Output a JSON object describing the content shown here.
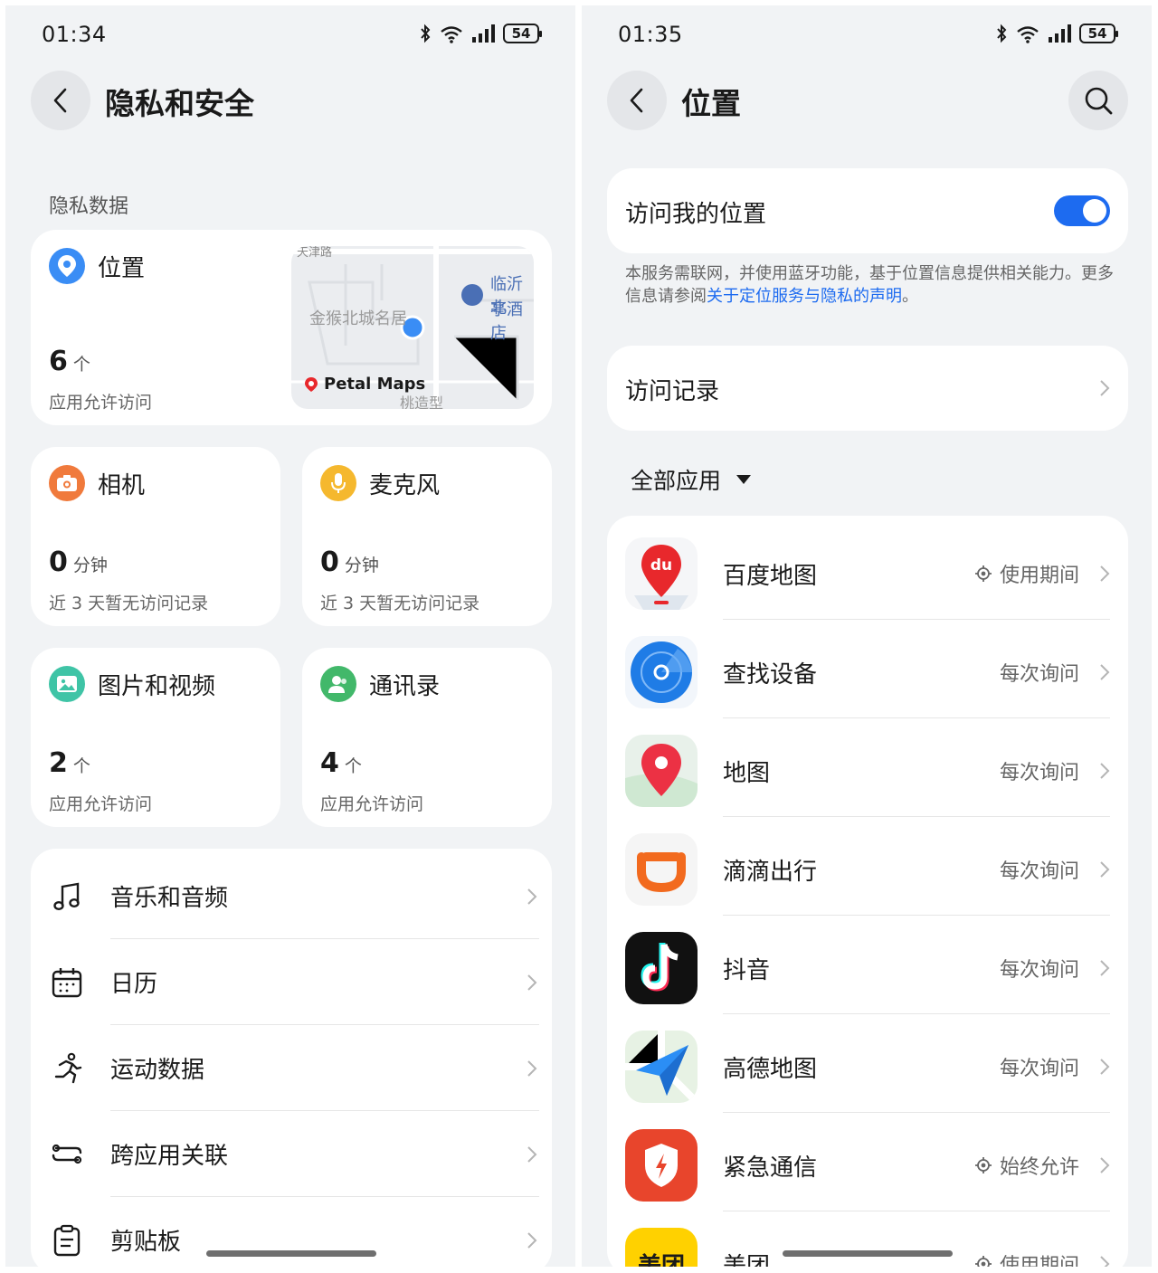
{
  "left_screen": {
    "status": {
      "time": "01:34",
      "battery": "54"
    },
    "title": "隐私和安全",
    "section_label": "隐私数据",
    "location_card": {
      "name": "位置",
      "count": "6",
      "unit": "个",
      "sub": "应用允许访问",
      "map": {
        "street": "天津路",
        "place": "金猴北城名居",
        "hotel_line1": "临沂北",
        "hotel_line2": "亭酒店",
        "brand": "Petal Maps",
        "place2": "桃造型"
      }
    },
    "camera_card": {
      "name": "相机",
      "count": "0",
      "unit": "分钟",
      "sub": "近 3 天暂无访问记录"
    },
    "mic_card": {
      "name": "麦克风",
      "count": "0",
      "unit": "分钟",
      "sub": "近 3 天暂无访问记录"
    },
    "photos_card": {
      "name": "图片和视频",
      "count": "2",
      "unit": "个",
      "sub": "应用允许访问"
    },
    "contacts_card": {
      "name": "通讯录",
      "count": "4",
      "unit": "个",
      "sub": "应用允许访问"
    },
    "list": [
      {
        "label": "音乐和音频",
        "icon": "music-note-icon"
      },
      {
        "label": "日历",
        "icon": "calendar-icon"
      },
      {
        "label": "运动数据",
        "icon": "running-icon"
      },
      {
        "label": "跨应用关联",
        "icon": "cross-app-icon"
      },
      {
        "label": "剪贴板",
        "icon": "clipboard-icon"
      }
    ]
  },
  "right_screen": {
    "status": {
      "time": "01:35",
      "battery": "54"
    },
    "title": "位置",
    "toggle_label": "访问我的位置",
    "toggle_on": true,
    "desc_text": "本服务需联网，并使用蓝牙功能，基于位置信息提供相关能力。更多信息请参阅",
    "desc_link": "关于定位服务与隐私的声明",
    "desc_end": "。",
    "history_label": "访问记录",
    "filter_label": "全部应用",
    "apps": [
      {
        "name": "百度地图",
        "status": "使用期间",
        "icon": "baidu-maps-icon"
      },
      {
        "name": "查找设备",
        "status": "每次询问",
        "icon": "find-device-icon"
      },
      {
        "name": "地图",
        "status": "每次询问",
        "icon": "maps-icon"
      },
      {
        "name": "滴滴出行",
        "status": "每次询问",
        "icon": "didi-icon"
      },
      {
        "name": "抖音",
        "status": "每次询问",
        "icon": "douyin-icon"
      },
      {
        "name": "高德地图",
        "status": "每次询问",
        "icon": "amap-icon"
      },
      {
        "name": "紧急通信",
        "status": "始终允许",
        "icon": "emergency-icon"
      },
      {
        "name": "美团",
        "status": "使用期间",
        "icon": "meituan-icon",
        "logo_text": "美团"
      }
    ],
    "colors": {
      "accent": "#1d6bf0",
      "baidu": "#e8282c",
      "didi": "#f26a1e",
      "emergency": "#e8452c",
      "meituan": "#ffd100"
    }
  }
}
